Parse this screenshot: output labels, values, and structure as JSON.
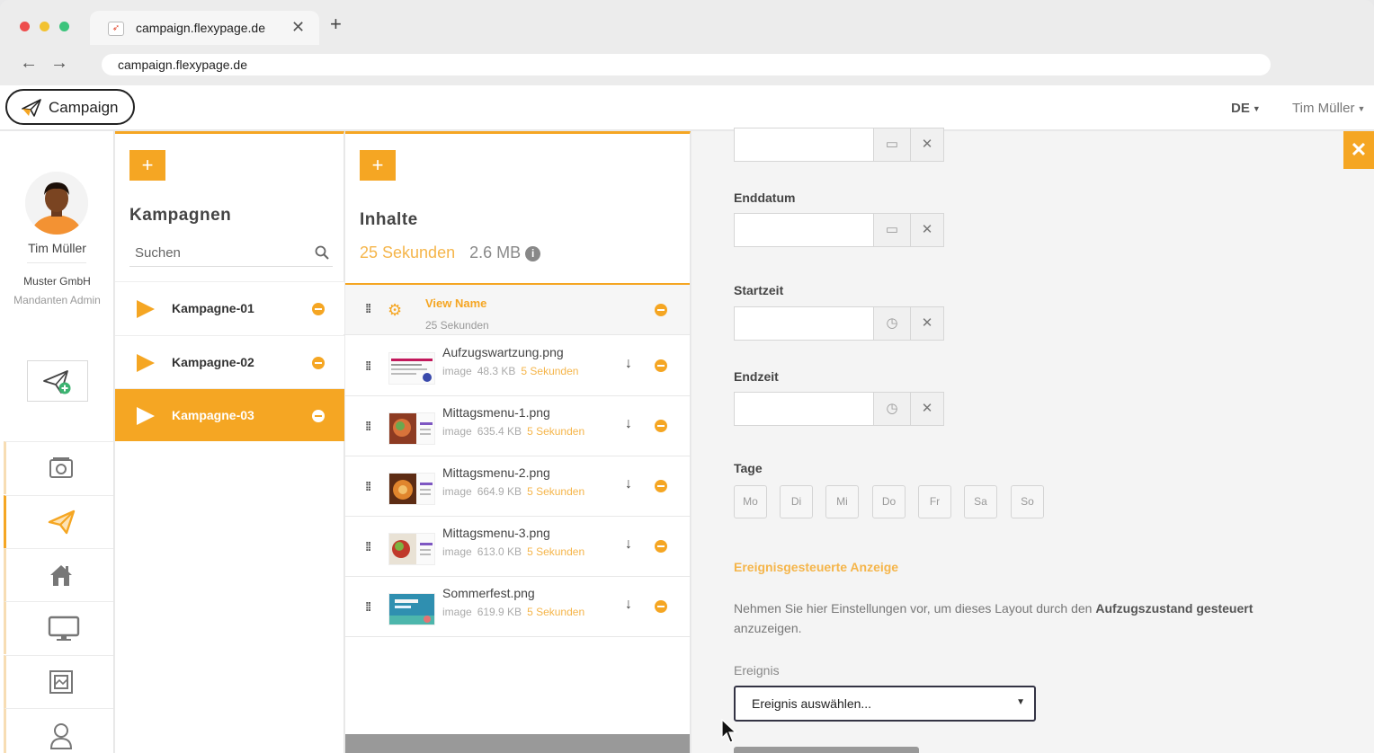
{
  "browser": {
    "tab_title": "campaign.flexypage.de",
    "url": "campaign.flexypage.de",
    "tab_close": "✕",
    "new_tab": "+",
    "back": "←",
    "forward": "→"
  },
  "app": {
    "brand": "Campaign",
    "lang": "DE",
    "user_menu": "Tim Müller",
    "caret": "▼"
  },
  "profile": {
    "name": "Tim Müller",
    "company": "Muster GmbH",
    "role": "Mandanten Admin"
  },
  "nav": [
    "media",
    "campaign",
    "home",
    "screen",
    "layout",
    "user"
  ],
  "campaigns": {
    "add_label": "+",
    "title": "Kampagnen",
    "search_placeholder": "Suchen",
    "items": [
      {
        "name": "Kampagne-01",
        "selected": false
      },
      {
        "name": "Kampagne-02",
        "selected": false
      },
      {
        "name": "Kampagne-03",
        "selected": true
      }
    ]
  },
  "contents": {
    "add_label": "+",
    "title": "Inhalte",
    "total_time": "25 Sekunden",
    "total_size": "2.6 MB",
    "info": "i",
    "view": {
      "name": "View Name",
      "duration": "25 Sekunden"
    },
    "items": [
      {
        "name": "Aufzugswartzung.png",
        "type": "image",
        "size": "48.3 KB",
        "duration": "5 Sekunden"
      },
      {
        "name": "Mittagsmenu-1.png",
        "type": "image",
        "size": "635.4 KB",
        "duration": "5 Sekunden"
      },
      {
        "name": "Mittagsmenu-2.png",
        "type": "image",
        "size": "664.9 KB",
        "duration": "5 Sekunden"
      },
      {
        "name": "Mittagsmenu-3.png",
        "type": "image",
        "size": "613.0 KB",
        "duration": "5 Sekunden"
      },
      {
        "name": "Sommerfest.png",
        "type": "image",
        "size": "619.9 KB",
        "duration": "5 Sekunden"
      }
    ]
  },
  "form": {
    "close": "✕",
    "enddatum_label": "Enddatum",
    "startzeit_label": "Startzeit",
    "endzeit_label": "Endzeit",
    "tage_label": "Tage",
    "days": [
      "Mo",
      "Di",
      "Mi",
      "Do",
      "Fr",
      "Sa",
      "So"
    ],
    "event_title": "Ereignisgesteuerte Anzeige",
    "event_desc_pre": "Nehmen Sie hier Einstellungen vor, um dieses Layout durch den ",
    "event_desc_bold": "Aufzugszustand gesteuert",
    "event_desc_post": " anzuzeigen.",
    "event_label": "Ereignis",
    "event_select": "Ereignis auswählen...",
    "clear": "✕"
  },
  "colors": {
    "accent": "#f5a623",
    "background": "#f4f4f4"
  }
}
